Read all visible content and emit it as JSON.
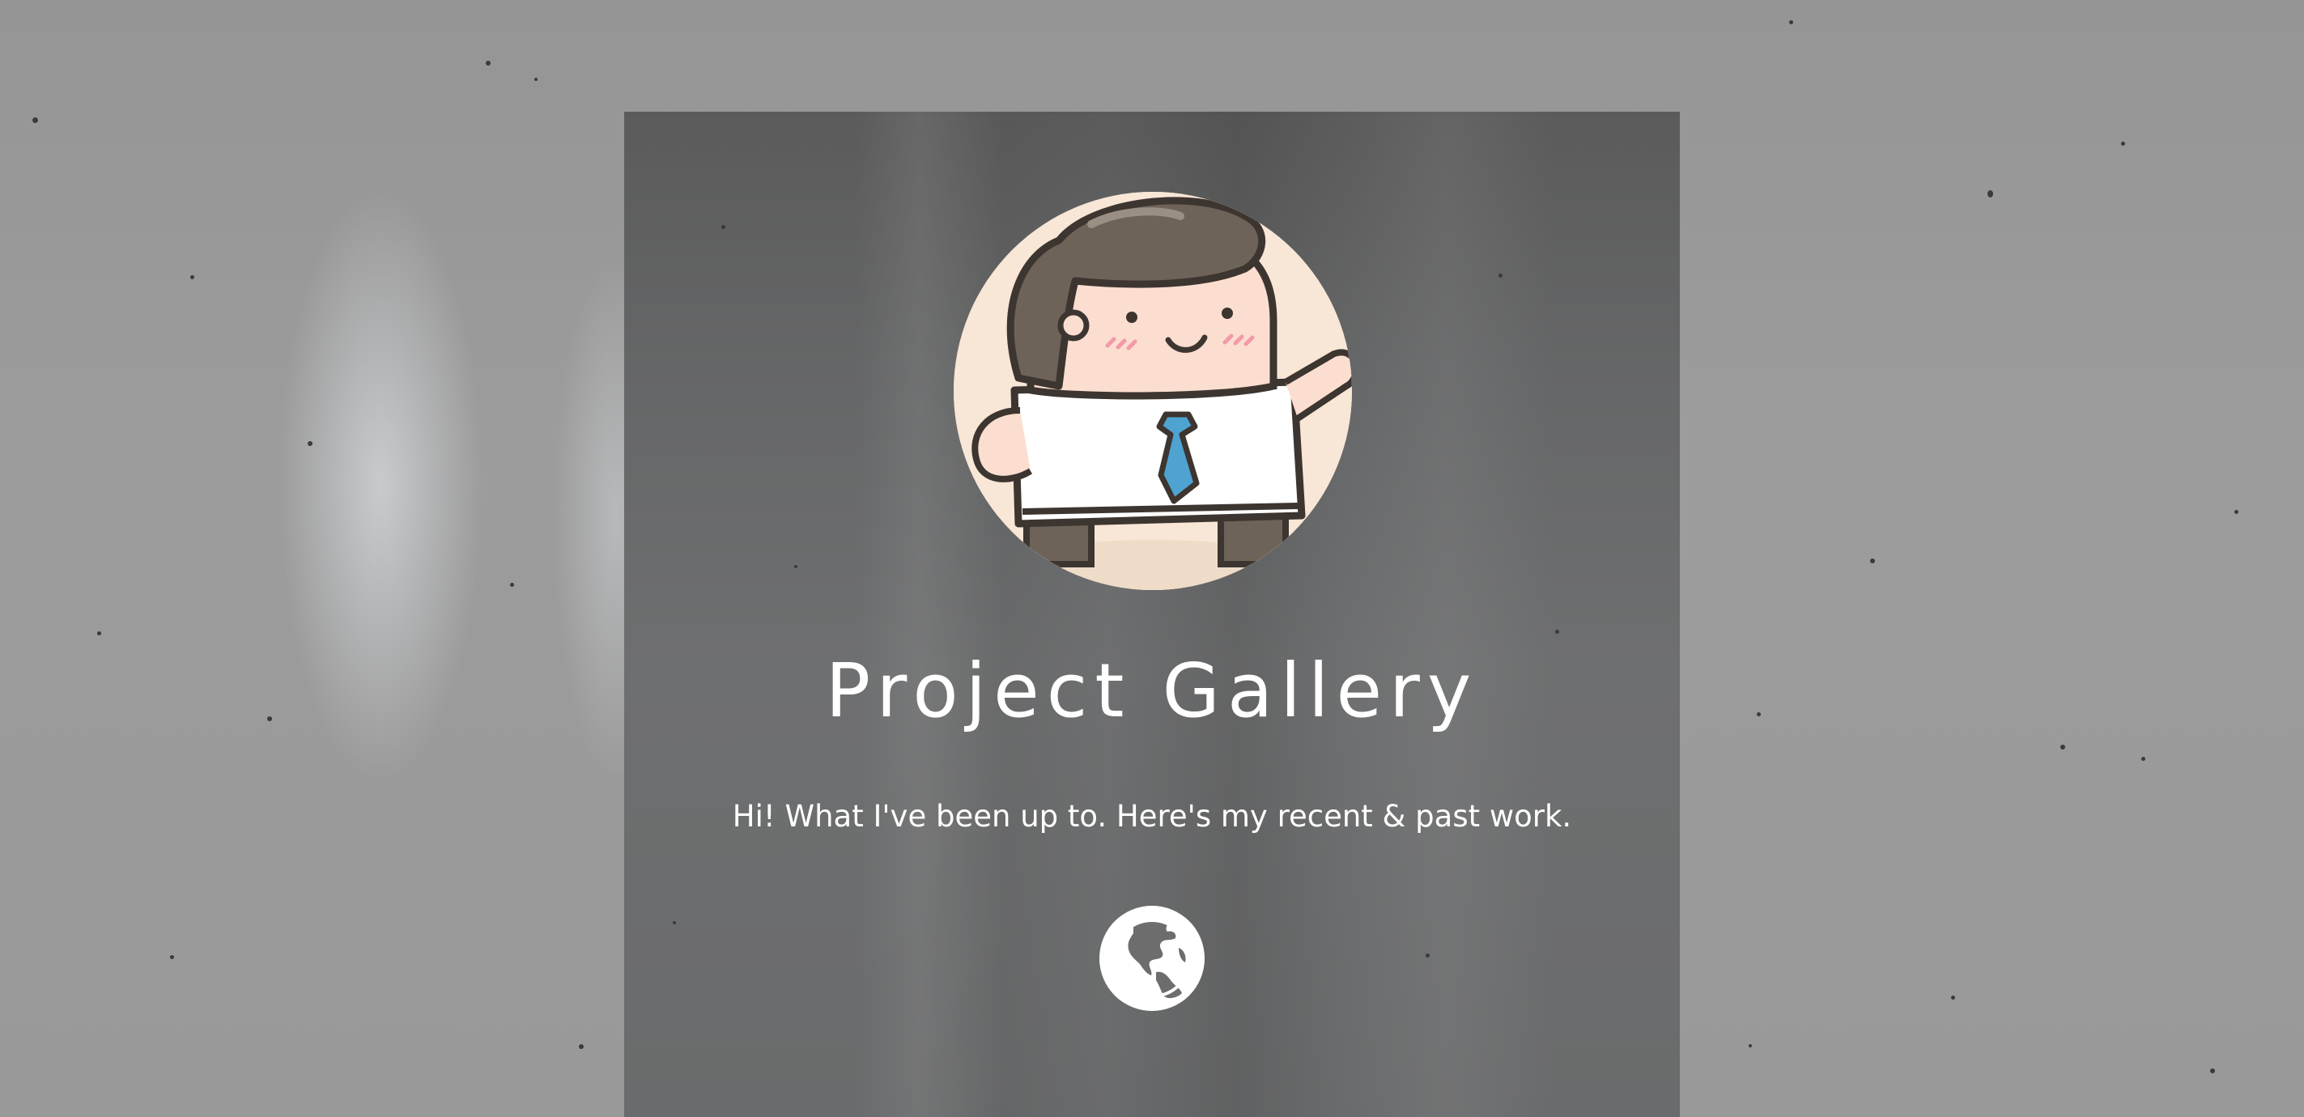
{
  "page": {
    "title": "Project Gallery",
    "subtitle": "Hi! What I've been up to. Here's my recent & past work."
  },
  "avatar": {
    "icon": "cartoon-office-worker"
  },
  "links": [
    {
      "icon": "globe-icon"
    }
  ],
  "colors": {
    "text": "#ffffff",
    "card_overlay": "#5b5b5b",
    "avatar_background": "#f8e6d6",
    "tie": "#4fa3d1"
  }
}
